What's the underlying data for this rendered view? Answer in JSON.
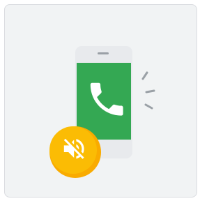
{
  "illustration": {
    "description_icons": [
      "phone-device-icon",
      "phone-handset-icon",
      "vibration-icon",
      "volume-off-icon"
    ],
    "colors": {
      "card_background": "#f1f3f4",
      "card_border": "#dadce0",
      "phone_body": "#e8eaed",
      "phone_screen": "#34a853",
      "speaker_slot": "#9aa0a6",
      "handset": "#ffffff",
      "vibration_lines": "#9aa0a6",
      "badge_outer": "#f9ab00",
      "badge_inner": "#fbbc04",
      "badge_icon": "#ffffff"
    }
  }
}
